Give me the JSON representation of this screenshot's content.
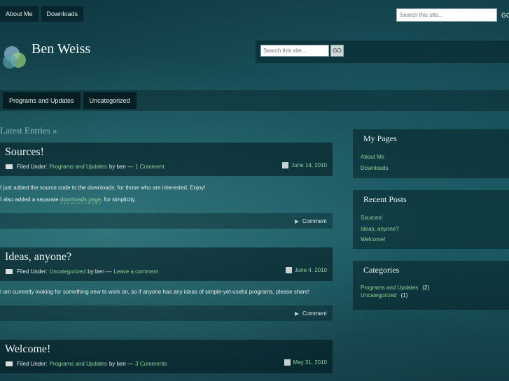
{
  "topnav": {
    "items": [
      "About Me",
      "Downloads"
    ]
  },
  "top_search": {
    "placeholder": "Search this site...",
    "go": "GO"
  },
  "header": {
    "title": "Ben Weiss",
    "search_placeholder": "Search this site...",
    "search_button": "GO"
  },
  "catnav": {
    "items": [
      "Programs and Updates",
      "Uncategorized"
    ]
  },
  "latest_label": "Latest Entries »",
  "posts": [
    {
      "title": "Sources!",
      "filed": "Filed Under:",
      "category": "Programs and Updates",
      "by": "by ben —",
      "comments": "1 Comment",
      "date": "June 14, 2010",
      "body1": "I just added the source code to the downloads, for those who are interested. Enjoy!",
      "body2_pre": "I also added a separate",
      "body2_link": "downloads page",
      "body2_post": ", for simplicity.",
      "comment_label": "Comment"
    },
    {
      "title": "Ideas, anyone?",
      "filed": "Filed Under:",
      "category": "Uncategorized",
      "by": "by ben —",
      "comments": "Leave a comment",
      "date": "June 4, 2010",
      "body1": "I am currently looking for something new to work on, so if anyone has any ideas of simple-yet-useful programs, please share!",
      "comment_label": "Comment"
    },
    {
      "title": "Welcome!",
      "filed": "Filed Under:",
      "category": "Programs and Updates",
      "by": "by ben —",
      "comments": "3 Comments",
      "date": "May 31, 2010"
    }
  ],
  "sidebar": {
    "my_pages": {
      "title": "My Pages",
      "links": [
        "About Me",
        "Downloads"
      ]
    },
    "recent_posts": {
      "title": "Recent Posts",
      "links": [
        "Sources!",
        "Ideas, anyone?",
        "Welcome!"
      ]
    },
    "categories": {
      "title": "Categories",
      "items": [
        {
          "name": "Programs and Updates",
          "count": "(2)"
        },
        {
          "name": "Uncategorized",
          "count": "(1)"
        }
      ]
    }
  },
  "colors": {
    "link": "#8fd19a",
    "background": "#164c55"
  }
}
